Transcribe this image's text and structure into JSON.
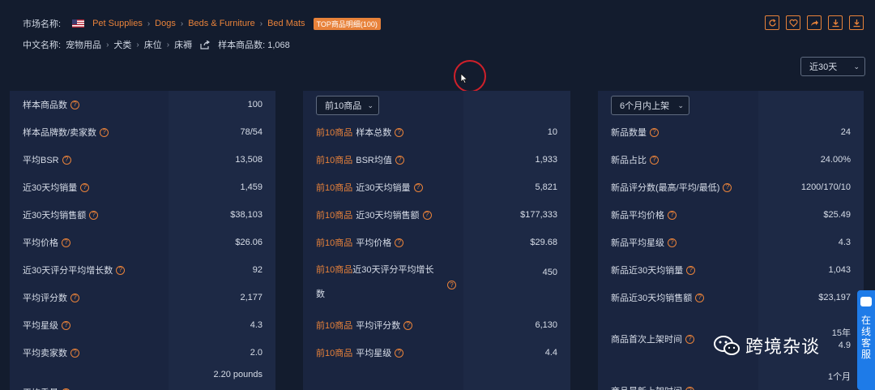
{
  "market": {
    "label": "市场名称:",
    "crumbs": [
      "Pet Supplies",
      "Dogs",
      "Beds & Furniture",
      "Bed Mats"
    ],
    "badge": "TOP商品明细(100)"
  },
  "cn": {
    "label": "中文名称:",
    "crumbs": [
      "宠物用品",
      "犬类",
      "床位",
      "床褥"
    ],
    "sample_label": "样本商品数: 1,068"
  },
  "period_select": "近30天",
  "top10_select": "前10商品",
  "new_select": "6个月内上架",
  "col1": [
    {
      "label": "样本商品数",
      "value": "100"
    },
    {
      "label": "样本品牌数/卖家数",
      "value": "78/54"
    },
    {
      "label": "平均BSR",
      "value": "13,508"
    },
    {
      "label": "近30天均销量",
      "value": "1,459"
    },
    {
      "label": "近30天均销售额",
      "value": "$38,103"
    },
    {
      "label": "平均价格",
      "value": "$26.06"
    },
    {
      "label": "近30天评分平均增长数",
      "value": "92"
    },
    {
      "label": "平均评分数",
      "value": "2,177"
    },
    {
      "label": "平均星级",
      "value": "4.3"
    },
    {
      "label": "平均卖家数",
      "value": "2.0"
    },
    {
      "label": "平均重量",
      "value": "2.20 pounds"
    }
  ],
  "col2": [
    {
      "prefix": "前10商品",
      "label": "样本总数",
      "value": "10"
    },
    {
      "prefix": "前10商品",
      "label": "BSR均值",
      "value": "1,933"
    },
    {
      "prefix": "前10商品",
      "label": "近30天均销量",
      "value": "5,821"
    },
    {
      "prefix": "前10商品",
      "label": "近30天均销售额",
      "value": "$177,333"
    },
    {
      "prefix": "前10商品",
      "label": "平均价格",
      "value": "$29.68"
    },
    {
      "prefix": "前10商品",
      "label": "近30天评分平均增长",
      "label2": "数",
      "value": "450"
    },
    {
      "prefix": "前10商品",
      "label": "平均评分数",
      "value": "6,130"
    },
    {
      "prefix": "前10商品",
      "label": "平均星级",
      "value": "4.4"
    }
  ],
  "col3": [
    {
      "label": "新品数量",
      "value": "24"
    },
    {
      "label": "新品占比",
      "value": "24.00%"
    },
    {
      "label": "新品评分数(最高/平均/最低)",
      "value": "1200/170/10"
    },
    {
      "label": "新品平均价格",
      "value": "$25.49"
    },
    {
      "label": "新品平均星级",
      "value": "4.3"
    },
    {
      "label": "新品近30天均销量",
      "value": "1,043"
    },
    {
      "label": "新品近30天均销售额",
      "value": "$23,197"
    },
    {
      "label": "商品首次上架时间",
      "value": "15年",
      "value2": "4.9"
    },
    {
      "label": "商品最新上架时间",
      "value": "1个月"
    }
  ],
  "watermark": "跨境杂谈",
  "service_chars": [
    "在",
    "线",
    "客",
    "服"
  ],
  "colors": {
    "accent": "#e8823a",
    "bg": "#131c2e",
    "panel": "#1a2540",
    "service": "#1e7be8"
  }
}
